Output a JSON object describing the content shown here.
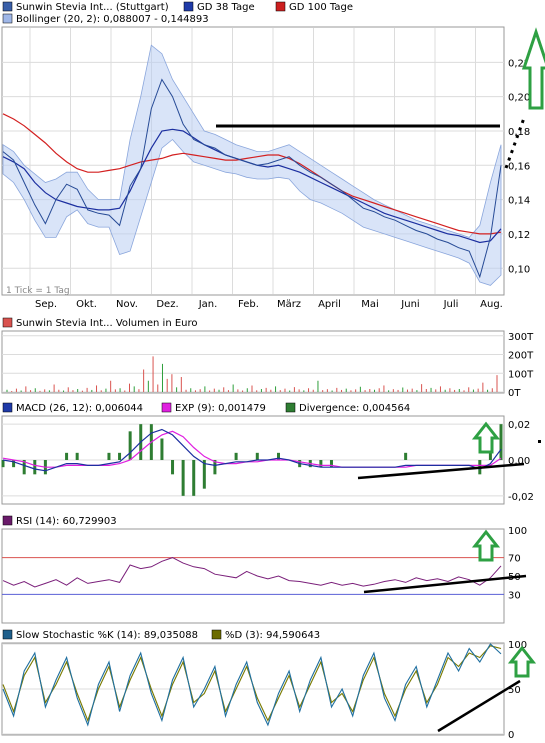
{
  "chart_data": [
    {
      "type": "line",
      "panel": "price",
      "legend": [
        {
          "label": "Sunwin Stevia Int... (Stuttgart)",
          "color": "#3a5fa8"
        },
        {
          "label": "GD 38 Tage",
          "color": "#1f3aa8"
        },
        {
          "label": "GD 100 Tage",
          "color": "#cc1f1f"
        }
      ],
      "legend2": [
        {
          "label": "Bollinger (20, 2): 0,088007 - 0,144893",
          "color": "#9fb7e8"
        }
      ],
      "x_ticks": [
        "Sep.",
        "Okt.",
        "Nov.",
        "Dez.",
        "Jan.",
        "Feb.",
        "März",
        "April",
        "Mai",
        "Juni",
        "Juli",
        "Aug."
      ],
      "y_ticks": [
        "0,22",
        "0,20",
        "0,18",
        "0,16",
        "0,14",
        "0,12",
        "0,10"
      ],
      "y_values": [
        0.22,
        0.2,
        0.18,
        0.16,
        0.14,
        0.12,
        0.1
      ],
      "ylim": [
        0.085,
        0.24
      ],
      "note": "1 Tick = 1 Tag",
      "series": [
        {
          "name": "Sunwin Stevia Int... (Stuttgart)",
          "values": [
            0.168,
            0.163,
            0.15,
            0.137,
            0.126,
            0.14,
            0.149,
            0.146,
            0.134,
            0.132,
            0.131,
            0.125,
            0.148,
            0.158,
            0.193,
            0.21,
            0.2,
            0.184,
            0.175,
            0.172,
            0.17,
            0.166,
            0.164,
            0.162,
            0.16,
            0.161,
            0.163,
            0.165,
            0.16,
            0.156,
            0.153,
            0.149,
            0.145,
            0.14,
            0.135,
            0.133,
            0.13,
            0.128,
            0.125,
            0.122,
            0.12,
            0.117,
            0.115,
            0.112,
            0.11,
            0.095,
            0.118,
            0.16
          ]
        },
        {
          "name": "GD 38 Tage",
          "values": [
            0.165,
            0.162,
            0.158,
            0.15,
            0.144,
            0.14,
            0.138,
            0.136,
            0.135,
            0.134,
            0.134,
            0.135,
            0.145,
            0.158,
            0.17,
            0.18,
            0.181,
            0.18,
            0.176,
            0.172,
            0.169,
            0.166,
            0.164,
            0.162,
            0.16,
            0.159,
            0.16,
            0.158,
            0.156,
            0.153,
            0.15,
            0.147,
            0.144,
            0.141,
            0.138,
            0.135,
            0.132,
            0.13,
            0.128,
            0.126,
            0.124,
            0.122,
            0.12,
            0.119,
            0.117,
            0.115,
            0.116,
            0.123
          ]
        },
        {
          "name": "GD 100 Tage",
          "values": [
            0.19,
            0.187,
            0.183,
            0.178,
            0.173,
            0.167,
            0.162,
            0.158,
            0.156,
            0.156,
            0.157,
            0.158,
            0.16,
            0.162,
            0.163,
            0.164,
            0.166,
            0.167,
            0.166,
            0.165,
            0.164,
            0.163,
            0.163,
            0.164,
            0.165,
            0.166,
            0.166,
            0.164,
            0.161,
            0.157,
            0.153,
            0.149,
            0.145,
            0.142,
            0.14,
            0.138,
            0.136,
            0.134,
            0.132,
            0.13,
            0.128,
            0.126,
            0.124,
            0.122,
            0.121,
            0.12,
            0.12,
            0.121
          ]
        },
        {
          "name": "Bollinger upper",
          "values": [
            0.172,
            0.168,
            0.16,
            0.155,
            0.15,
            0.152,
            0.156,
            0.156,
            0.146,
            0.14,
            0.14,
            0.14,
            0.175,
            0.2,
            0.23,
            0.225,
            0.21,
            0.2,
            0.19,
            0.18,
            0.178,
            0.175,
            0.172,
            0.17,
            0.168,
            0.168,
            0.17,
            0.172,
            0.168,
            0.164,
            0.16,
            0.156,
            0.152,
            0.148,
            0.144,
            0.14,
            0.137,
            0.134,
            0.131,
            0.128,
            0.126,
            0.124,
            0.122,
            0.12,
            0.118,
            0.125,
            0.15,
            0.172
          ]
        },
        {
          "name": "Bollinger lower",
          "values": [
            0.155,
            0.15,
            0.14,
            0.128,
            0.118,
            0.118,
            0.13,
            0.134,
            0.126,
            0.124,
            0.124,
            0.108,
            0.11,
            0.13,
            0.15,
            0.17,
            0.175,
            0.168,
            0.162,
            0.16,
            0.158,
            0.156,
            0.155,
            0.153,
            0.152,
            0.152,
            0.153,
            0.152,
            0.145,
            0.14,
            0.138,
            0.135,
            0.132,
            0.128,
            0.124,
            0.122,
            0.12,
            0.118,
            0.116,
            0.114,
            0.112,
            0.11,
            0.108,
            0.106,
            0.103,
            0.092,
            0.09,
            0.096
          ]
        }
      ],
      "annotations": {
        "resistance_level": 0.162
      }
    },
    {
      "type": "bar",
      "panel": "volume",
      "legend": [
        {
          "label": "Sunwin Stevia Int... Volumen in Euro",
          "color": "#d9534f"
        }
      ],
      "y_ticks": [
        "300T",
        "200T",
        "100T",
        "0T"
      ],
      "y_values": [
        300,
        200,
        100,
        0
      ],
      "ylim": [
        0,
        320
      ],
      "values": [
        12,
        5,
        18,
        8,
        30,
        10,
        20,
        6,
        14,
        9,
        40,
        12,
        8,
        25,
        10,
        16,
        7,
        22,
        11,
        35,
        9,
        18,
        60,
        14,
        20,
        8,
        45,
        30,
        15,
        120,
        60,
        190,
        40,
        150,
        70,
        95,
        25,
        80,
        12,
        20,
        9,
        15,
        30,
        8,
        18,
        12,
        25,
        10,
        40,
        14,
        8,
        20,
        35,
        9,
        16,
        22,
        12,
        30,
        10,
        18,
        8,
        26,
        14,
        9,
        20,
        12,
        60,
        10,
        15,
        8,
        22,
        11,
        18,
        9,
        14,
        28,
        10,
        16,
        12,
        20,
        35,
        9,
        15,
        11,
        24,
        13,
        18,
        10,
        42,
        16,
        22,
        14,
        30,
        12,
        20,
        11,
        16,
        9,
        25,
        13,
        18,
        50,
        12,
        20,
        90
      ]
    },
    {
      "type": "line",
      "panel": "macd",
      "legend": [
        {
          "label": "MACD (26, 12): 0,006044",
          "color": "#1f3aa8"
        },
        {
          "label": "EXP (9): 0,001479",
          "color": "#e020e0"
        },
        {
          "label": "Divergence: 0,004564",
          "color": "#2e7d32"
        }
      ],
      "y_ticks": [
        "0,02",
        "0,00",
        "-0,02"
      ],
      "y_values": [
        0.02,
        0.0,
        -0.02
      ],
      "ylim": [
        -0.024,
        0.024
      ],
      "series": [
        {
          "name": "MACD (26, 12)",
          "values": [
            0.0,
            -0.001,
            -0.003,
            -0.005,
            -0.006,
            -0.004,
            -0.002,
            -0.002,
            -0.003,
            -0.003,
            -0.002,
            -0.001,
            0.004,
            0.01,
            0.015,
            0.017,
            0.014,
            0.008,
            0.002,
            -0.002,
            -0.003,
            -0.002,
            -0.001,
            -0.001,
            0.0,
            0.0,
            0.001,
            0.0,
            -0.002,
            -0.003,
            -0.004,
            -0.004,
            -0.004,
            -0.004,
            -0.004,
            -0.004,
            -0.004,
            -0.004,
            -0.003,
            -0.003,
            -0.003,
            -0.003,
            -0.003,
            -0.003,
            -0.003,
            -0.005,
            -0.002,
            0.006
          ]
        },
        {
          "name": "EXP (9)",
          "values": [
            0.001,
            0.0,
            -0.001,
            -0.003,
            -0.004,
            -0.004,
            -0.003,
            -0.003,
            -0.003,
            -0.003,
            -0.003,
            -0.002,
            0.0,
            0.005,
            0.01,
            0.014,
            0.016,
            0.013,
            0.007,
            0.002,
            -0.001,
            -0.002,
            -0.002,
            -0.001,
            -0.001,
            0.0,
            0.0,
            0.0,
            -0.001,
            -0.002,
            -0.003,
            -0.003,
            -0.004,
            -0.004,
            -0.004,
            -0.004,
            -0.004,
            -0.004,
            -0.004,
            -0.003,
            -0.003,
            -0.003,
            -0.003,
            -0.003,
            -0.003,
            -0.003,
            -0.003,
            0.001
          ]
        }
      ]
    },
    {
      "type": "line",
      "panel": "rsi",
      "legend": [
        {
          "label": "RSI (14): 60,729903",
          "color": "#6a1b6a"
        }
      ],
      "y_ticks": [
        "100",
        "70",
        "50",
        "30"
      ],
      "y_values": [
        100,
        70,
        50,
        30
      ],
      "ylim": [
        0,
        100
      ],
      "hlines": [
        {
          "y": 70,
          "color": "#d9534f"
        },
        {
          "y": 30,
          "color": "#5a5fd6"
        }
      ],
      "values": [
        45,
        40,
        44,
        38,
        42,
        46,
        40,
        48,
        42,
        44,
        46,
        43,
        62,
        58,
        60,
        66,
        70,
        64,
        60,
        58,
        52,
        50,
        48,
        55,
        50,
        47,
        50,
        45,
        44,
        42,
        40,
        43,
        40,
        42,
        39,
        41,
        44,
        46,
        43,
        48,
        45,
        47,
        44,
        49,
        46,
        40,
        48,
        61
      ]
    },
    {
      "type": "line",
      "panel": "stochastic",
      "legend": [
        {
          "label": "Slow Stochastic %K (14): 89,035088",
          "color": "#1f5f8b"
        },
        {
          "label": "%D (3): 94,590643",
          "color": "#6b6b00"
        }
      ],
      "y_ticks": [
        "100",
        "50",
        "0"
      ],
      "y_values": [
        100,
        50,
        0
      ],
      "ylim": [
        0,
        100
      ],
      "series": [
        {
          "name": "Slow Stochastic %K (14)",
          "values": [
            50,
            20,
            70,
            90,
            30,
            60,
            85,
            40,
            10,
            55,
            80,
            25,
            65,
            90,
            45,
            15,
            60,
            85,
            30,
            50,
            75,
            20,
            55,
            80,
            35,
            10,
            45,
            70,
            25,
            60,
            85,
            30,
            50,
            20,
            65,
            90,
            40,
            15,
            55,
            75,
            30,
            60,
            90,
            70,
            95,
            80,
            100,
            89
          ]
        },
        {
          "name": "%D (3)",
          "values": [
            55,
            25,
            65,
            85,
            35,
            55,
            80,
            45,
            15,
            50,
            75,
            30,
            60,
            85,
            50,
            20,
            55,
            80,
            35,
            45,
            70,
            25,
            50,
            75,
            40,
            15,
            40,
            65,
            30,
            55,
            80,
            35,
            45,
            25,
            60,
            85,
            45,
            20,
            50,
            70,
            35,
            55,
            85,
            75,
            90,
            85,
            98,
            95
          ]
        }
      ]
    }
  ]
}
